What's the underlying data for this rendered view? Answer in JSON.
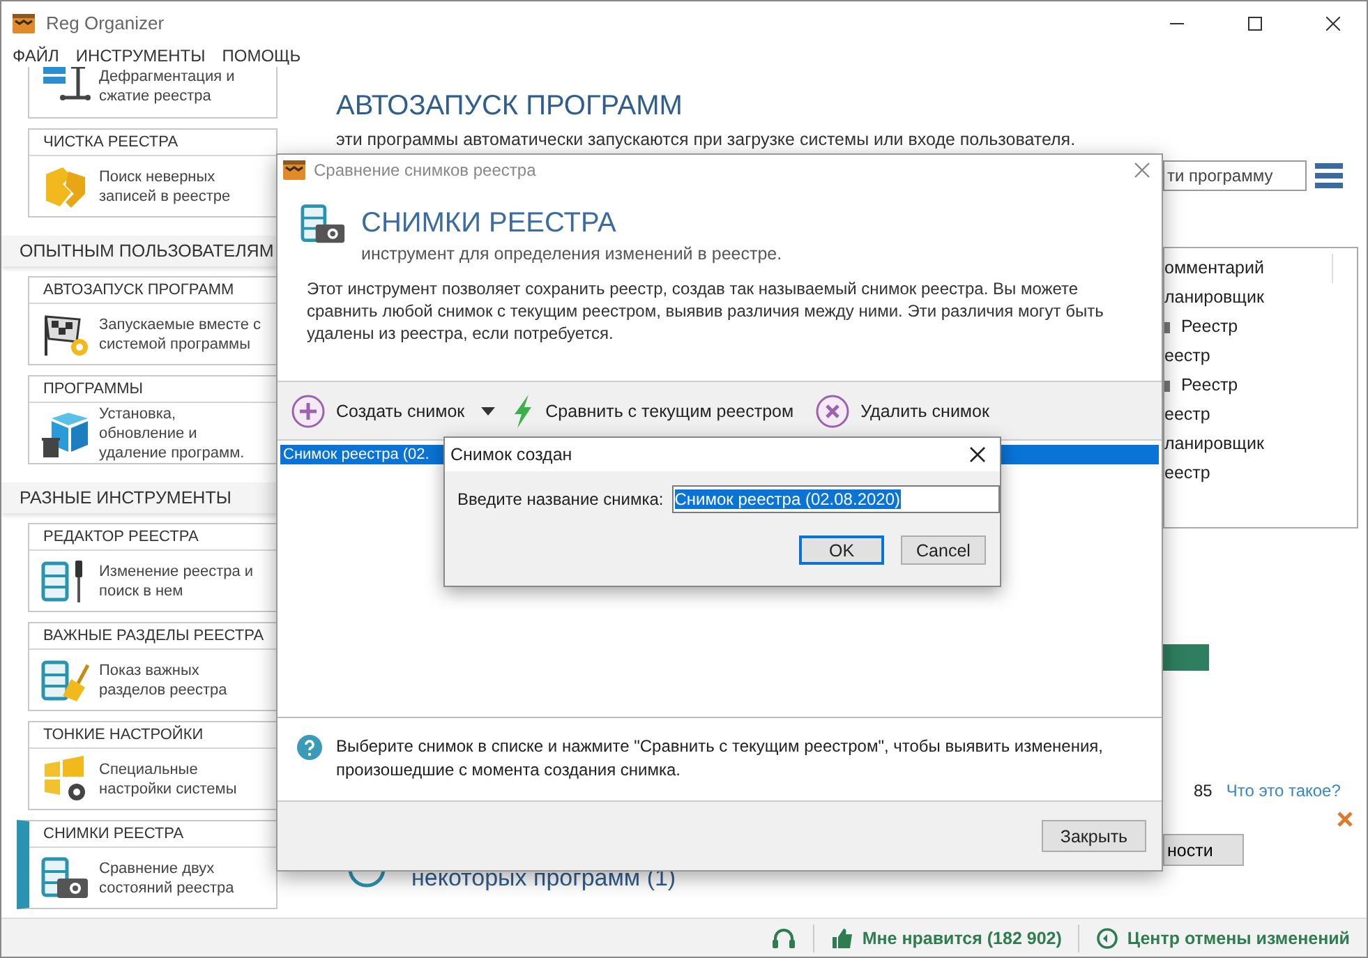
{
  "window": {
    "title": "Reg Organizer"
  },
  "menu": [
    "ФАЙЛ",
    "ИНСТРУМЕНТЫ",
    "ПОМОЩЬ"
  ],
  "sidebar": {
    "sections": [
      {
        "items": [
          {
            "kind": "defrag",
            "description": "Дефрагментация и сжатие реестра",
            "selected": false
          },
          {
            "kind": "cleaner",
            "title": "ЧИСТКА РЕЕСТРА",
            "description": "Поиск неверных записей в реестре",
            "selected": false
          }
        ]
      },
      {
        "title": "ОПЫТНЫМ ПОЛЬЗОВАТЕЛЯМ",
        "items": [
          {
            "kind": "autorun",
            "title": "АВТОЗАПУСК ПРОГРАММ",
            "description": "Запускаемые вместе с системой программы",
            "selected": false
          },
          {
            "kind": "programs",
            "title": "ПРОГРАММЫ",
            "description": "Установка, обновление и удаление программ.",
            "selected": false
          }
        ]
      },
      {
        "title": "РАЗНЫЕ ИНСТРУМЕНТЫ",
        "items": [
          {
            "kind": "editor",
            "title": "РЕДАКТОР РЕЕСТРА",
            "description": "Изменение реестра и поиск в нем",
            "selected": false
          },
          {
            "kind": "important",
            "title": "ВАЖНЫЕ РАЗДЕЛЫ РЕЕСТРА",
            "description": "Показ важных разделов реестра",
            "selected": false
          },
          {
            "kind": "tweaks",
            "title": "ТОНКИЕ НАСТРОЙКИ",
            "description": "Специальные настройки системы",
            "selected": false
          },
          {
            "kind": "snapshots",
            "title": "СНИМКИ РЕЕСТРА",
            "description": "Сравнение двух состояний реестра",
            "selected": true
          }
        ]
      }
    ]
  },
  "content": {
    "title": "АВТОЗАПУСК ПРОГРАММ",
    "subtitle": "эти программы автоматически запускаются при загрузке системы или входе пользователя.",
    "search": {
      "placeholder": "ти программу"
    },
    "list": [
      {
        "kind": "header",
        "text": "омментарий"
      },
      {
        "kind": "row",
        "text": "ланировщик"
      },
      {
        "kind": "icon_row",
        "text": "Реестр"
      },
      {
        "kind": "row",
        "text": "еестр"
      },
      {
        "kind": "icon_row",
        "text": "Реестр"
      },
      {
        "kind": "row",
        "text": "еестр"
      },
      {
        "kind": "row",
        "text": "ланировщик"
      },
      {
        "kind": "row",
        "text": "еестр"
      }
    ],
    "value": "85",
    "link": "Что это такое?",
    "button": "ности",
    "item_title": "некоторых программ (1)"
  },
  "snapshot_dialog": {
    "title": "Сравнение снимков реестра",
    "heading": "СНИМКИ РЕЕСТРА",
    "subheading": "инструмент для определения изменений в реестре.",
    "description": "Этот инструмент позволяет сохранить реестр, создав так называемый снимок реестра. Вы можете сравнить любой снимок с текущим реестром, выявив различия между ними. Эти различия могут быть удалены из реестра, если потребуется.",
    "toolbar": [
      {
        "kind": "create",
        "label": "Создать снимок"
      },
      {
        "kind": "compare",
        "label": "Сравнить с текущим реестром"
      },
      {
        "kind": "delete",
        "label": "Удалить снимок"
      }
    ],
    "snapshots": [
      {
        "name": "Снимок реестра (02.",
        "selected": true
      }
    ],
    "hint": "Выберите снимок в списке и нажмите \"Сравнить с текущим реестром\", чтобы выявить изменения, произошедшие с момента создания снимка.",
    "close_button": "Закрыть"
  },
  "name_dialog": {
    "title": "Снимок создан",
    "label": "Введите название снимка:",
    "value": "Снимок реестра (02.08.2020)",
    "buttons": [
      {
        "label": "OK",
        "default": true
      },
      {
        "label": "Cancel",
        "default": false
      }
    ]
  },
  "status_bar": [
    {
      "kind": "support"
    },
    {
      "kind": "like",
      "text": "Мне нравится (182 902)"
    },
    {
      "kind": "undo",
      "text": "Центр отмены изменений"
    }
  ]
}
